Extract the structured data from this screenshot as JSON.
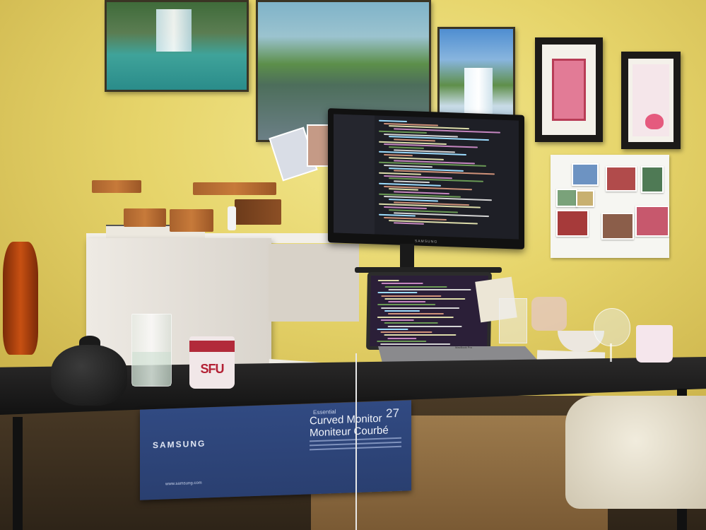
{
  "scene": {
    "box": {
      "brand": "SAMSUNG",
      "line1": "Essential",
      "line2": "Curved Monitor",
      "line3": "Moniteur Courbé",
      "size": "27",
      "url": "www.samsung.com"
    },
    "mug_text": "SFU",
    "monitor_brand": "SAMSUNG",
    "laptop_brand": "MacBook Pro"
  },
  "colors": {
    "wall": "#e6d46a",
    "desk": "#1f1f1f",
    "box": "#2a3f70",
    "mug_text": "#b32034"
  }
}
